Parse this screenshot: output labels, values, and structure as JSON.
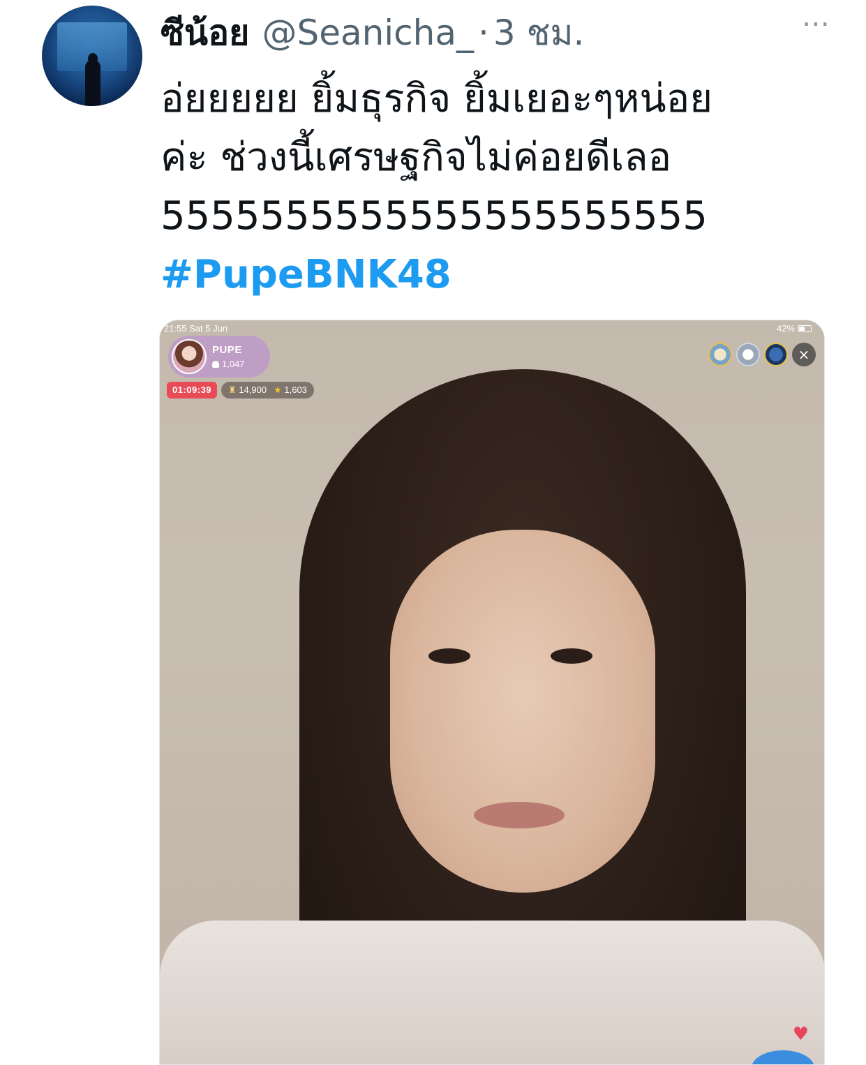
{
  "tweet": {
    "display_name": "ซีน้อย",
    "handle": "@Seanicha_",
    "separator": "·",
    "time": "3 ชม.",
    "more_icon": "⋯",
    "text_lines": [
      "อ่ยยยยย ยิ้มธุรกิจ ยิ้มเยอะๆหน่อย",
      "ค่ะ  ช่วงนี้เศรษฐกิจไม่ค่อยดีเลอ",
      "5555555555555555555555"
    ],
    "hashtag": "#PupeBNK48"
  },
  "media": {
    "status_time": "21:55  Sat 5 Jun",
    "battery": "42%",
    "live_name": "PUPE",
    "live_viewers": "1,047",
    "timer": "01:09:39",
    "gift_count": "14,900",
    "star_count": "1,603",
    "close_icon": "×",
    "heart_icon": "♥",
    "gift_icon": "♜",
    "star_icon": "★"
  },
  "colors": {
    "hashtag": "#1d9bf0",
    "secondary_text": "#536471",
    "timer_bg": "#e84b55"
  }
}
